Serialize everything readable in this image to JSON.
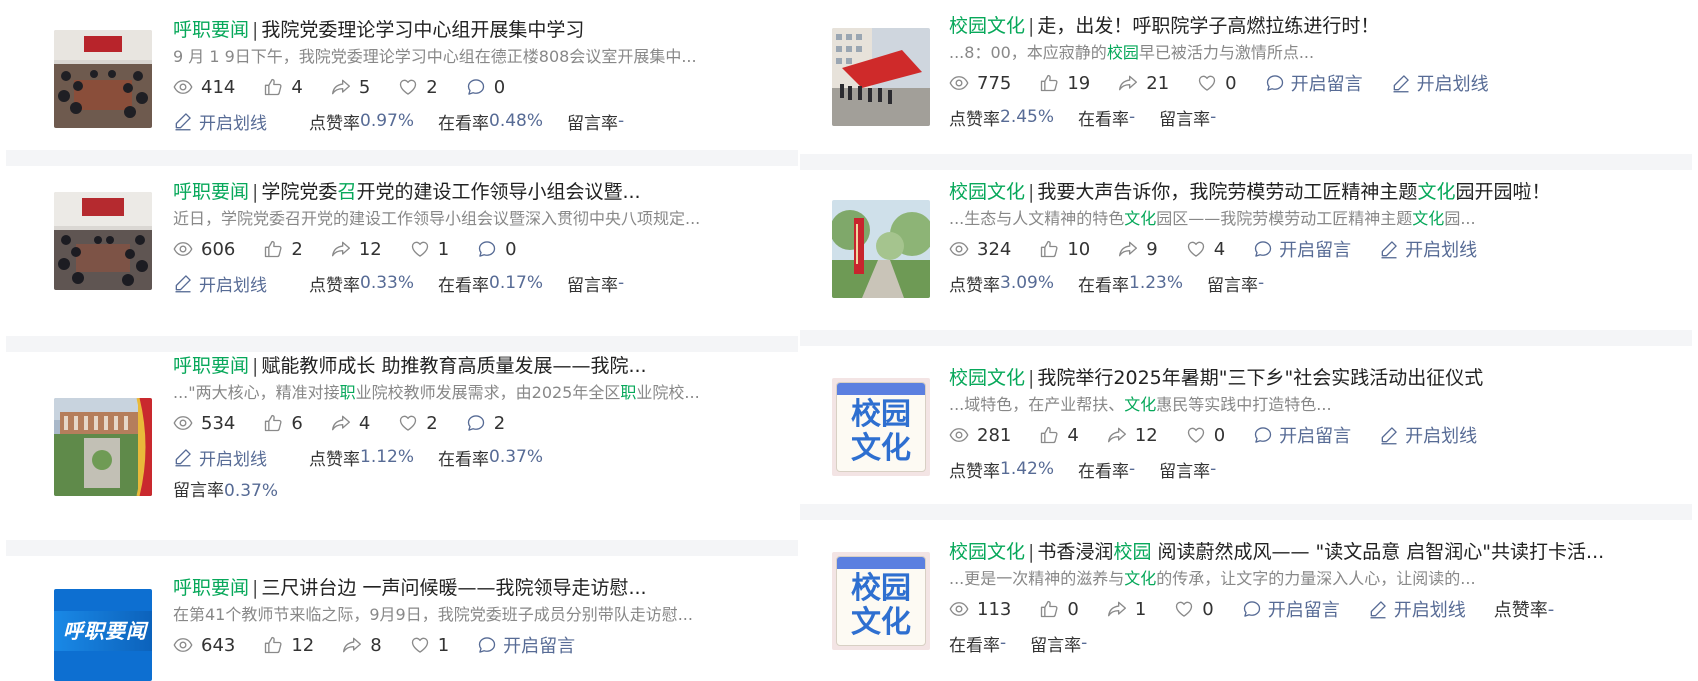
{
  "left": [
    {
      "category": "呼职要闻",
      "title": "我院党委理论学习中心组开展集中学习",
      "summary": "9 月 1 9日下午，我院党委理论学习中心组在德正楼808会议室开展集中...",
      "views": "414",
      "likes": "4",
      "shares": "5",
      "hearts": "2",
      "comments": "0",
      "underline_label": "开启划线",
      "like_rate_label": "点赞率",
      "like_rate": "0.97%",
      "watch_rate_label": "在看率",
      "watch_rate": "0.48%",
      "comment_rate_label": "留言率",
      "comment_rate": "-"
    },
    {
      "category": "呼职要闻",
      "title_pre": "学院党委",
      "title_hl": "召",
      "title_post": "开党的建设工作领导小组会议暨...",
      "summary": "近日，学院党委召开党的建设工作领导小组会议暨深入贯彻中央八项规定...",
      "views": "606",
      "likes": "2",
      "shares": "12",
      "hearts": "1",
      "comments": "0",
      "underline_label": "开启划线",
      "like_rate_label": "点赞率",
      "like_rate": "0.33%",
      "watch_rate_label": "在看率",
      "watch_rate": "0.17%",
      "comment_rate_label": "留言率",
      "comment_rate": "-"
    },
    {
      "category": "呼职要闻",
      "title": "赋能教师成长 助推教育高质量发展——我院...",
      "summary_1": "...\"两大核心，精准对接",
      "summary_hl_1": "职",
      "summary_2": "业院校教师发展需求，由2025年全区",
      "summary_hl_2": "职",
      "summary_3": "业院校...",
      "views": "534",
      "likes": "6",
      "shares": "4",
      "hearts": "2",
      "comments": "2",
      "underline_label": "开启划线",
      "like_rate_label": "点赞率",
      "like_rate": "1.12%",
      "watch_rate_label": "在看率",
      "watch_rate": "0.37%",
      "comment_rate_label": "留言率",
      "comment_rate": "0.37%"
    },
    {
      "category": "呼职要闻",
      "title": "三尺讲台边 一声问候暖——我院领导走访慰...",
      "summary": "在第41个教师节来临之际，9月9日，我院党委班子成员分别带队走访慰...",
      "views": "643",
      "likes": "12",
      "shares": "8",
      "hearts": "1",
      "open_comment_label": "开启留言",
      "thumb_text": "呼职要闻"
    }
  ],
  "right": [
    {
      "category": "校园文化",
      "title": "走，出发！呼职院学子高燃拉练进行时！",
      "summary_1": "...8：00，本应寂静的",
      "summary_hl_1": "校园",
      "summary_2": "早已被活力与激情所点...",
      "views": "775",
      "likes": "19",
      "shares": "21",
      "hearts": "0",
      "open_comment_label": "开启留言",
      "underline_label": "开启划线",
      "like_rate_label": "点赞率",
      "like_rate": "2.45%",
      "watch_rate_label": "在看率",
      "watch_rate": "-",
      "comment_rate_label": "留言率",
      "comment_rate": "-"
    },
    {
      "category": "校园文化",
      "title_pre": "我要大声告诉你，我院劳模劳动工匠精神主题",
      "title_hl": "文化",
      "title_post": "园开园啦！",
      "summary_1": "...生态与人文精神的特色",
      "summary_hl_1": "文化",
      "summary_2": "园区——我院劳模劳动工匠精神主题",
      "summary_hl_2": "文化",
      "summary_3": "园...",
      "views": "324",
      "likes": "10",
      "shares": "9",
      "hearts": "4",
      "open_comment_label": "开启留言",
      "underline_label": "开启划线",
      "like_rate_label": "点赞率",
      "like_rate": "3.09%",
      "watch_rate_label": "在看率",
      "watch_rate": "1.23%",
      "comment_rate_label": "留言率",
      "comment_rate": "-"
    },
    {
      "category": "校园文化",
      "title": "我院举行2025年暑期\"三下乡\"社会实践活动出征仪式",
      "summary_1": "...域特色，在产业帮扶、",
      "summary_hl_1": "文化",
      "summary_2": "惠民等实践中打造特色...",
      "views": "281",
      "likes": "4",
      "shares": "12",
      "hearts": "0",
      "open_comment_label": "开启留言",
      "underline_label": "开启划线",
      "like_rate_label": "点赞率",
      "like_rate": "1.42%",
      "watch_rate_label": "在看率",
      "watch_rate": "-",
      "comment_rate_label": "留言率",
      "comment_rate": "-",
      "thumb_line1": "校园",
      "thumb_line2": "文化"
    },
    {
      "category": "校园文化",
      "title_pre": "书香浸润",
      "title_hl": "校园",
      "title_post": " 阅读蔚然成风—— \"读文品意 启智润心\"共读打卡活...",
      "summary_1": "...更是一次精神的滋养与",
      "summary_hl_1": "文化",
      "summary_2": "的传承，让文字的力量深入人心，让阅读的...",
      "views": "113",
      "likes": "0",
      "shares": "1",
      "hearts": "0",
      "open_comment_label": "开启留言",
      "underline_label": "开启划线",
      "like_rate_label": "点赞率",
      "like_rate": "-",
      "watch_rate_label": "在看率",
      "watch_rate": "-",
      "comment_rate_label": "留言率",
      "comment_rate": "-",
      "thumb_line1": "校园",
      "thumb_line2": "文化"
    }
  ],
  "colors": {
    "accent_green": "#07a85a",
    "link_blue": "#576b95",
    "muted": "#888888",
    "separator": "#f4f5f7"
  },
  "icons": [
    "eye-icon",
    "thumb-up-icon",
    "share-icon",
    "heart-icon",
    "comment-icon",
    "pen-icon"
  ]
}
